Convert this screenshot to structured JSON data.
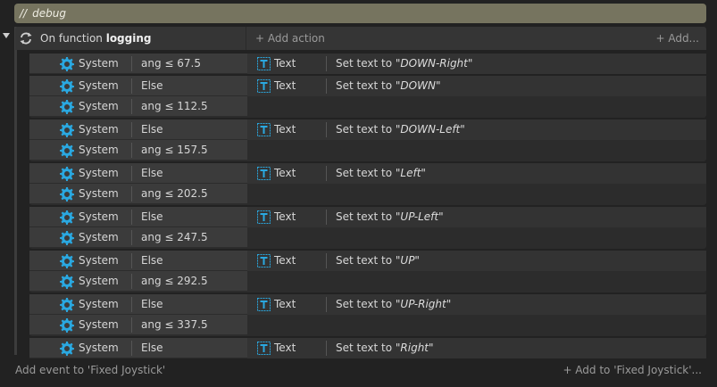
{
  "comment": {
    "prefix": "//",
    "text": "debug"
  },
  "function_block": {
    "prefix": "On function ",
    "name": "logging",
    "add_action_label": "+ Add action",
    "add_more_label": "+ Add..."
  },
  "events": [
    {
      "conditions": [
        {
          "object": "System",
          "text": "ang ≤ 67.5"
        }
      ],
      "action": {
        "object": "Text",
        "prefix": "Set text to ",
        "value": "\"DOWN-Right\""
      }
    },
    {
      "conditions": [
        {
          "object": "System",
          "text": "Else"
        },
        {
          "object": "System",
          "text": "ang ≤ 112.5"
        }
      ],
      "action": {
        "object": "Text",
        "prefix": "Set text to ",
        "value": "\"DOWN\""
      }
    },
    {
      "conditions": [
        {
          "object": "System",
          "text": "Else"
        },
        {
          "object": "System",
          "text": "ang ≤ 157.5"
        }
      ],
      "action": {
        "object": "Text",
        "prefix": "Set text to ",
        "value": "\"DOWN-Left\""
      }
    },
    {
      "conditions": [
        {
          "object": "System",
          "text": "Else"
        },
        {
          "object": "System",
          "text": "ang ≤ 202.5"
        }
      ],
      "action": {
        "object": "Text",
        "prefix": "Set text to ",
        "value": "\"Left\""
      }
    },
    {
      "conditions": [
        {
          "object": "System",
          "text": "Else"
        },
        {
          "object": "System",
          "text": "ang ≤ 247.5"
        }
      ],
      "action": {
        "object": "Text",
        "prefix": "Set text to ",
        "value": "\"UP-Left\""
      }
    },
    {
      "conditions": [
        {
          "object": "System",
          "text": "Else"
        },
        {
          "object": "System",
          "text": "ang ≤ 292.5"
        }
      ],
      "action": {
        "object": "Text",
        "prefix": "Set text to ",
        "value": "\"UP\""
      }
    },
    {
      "conditions": [
        {
          "object": "System",
          "text": "Else"
        },
        {
          "object": "System",
          "text": "ang ≤ 337.5"
        }
      ],
      "action": {
        "object": "Text",
        "prefix": "Set text to ",
        "value": "\"UP-Right\""
      }
    },
    {
      "conditions": [
        {
          "object": "System",
          "text": "Else"
        }
      ],
      "action": {
        "object": "Text",
        "prefix": "Set text to ",
        "value": "\"Right\""
      }
    }
  ],
  "footer": {
    "add_event_label": "Add event to 'Fixed Joystick'",
    "add_to_label": "+ Add to 'Fixed Joystick'..."
  },
  "colors": {
    "comment_bg": "#76745f",
    "gear_icon": "#2aa8e0",
    "text_icon": "#2aa8e0"
  },
  "icons": {
    "function": "repeat-icon",
    "system": "gear-icon",
    "text_object": "text-object-icon",
    "collapse": "triangle-down-icon"
  }
}
